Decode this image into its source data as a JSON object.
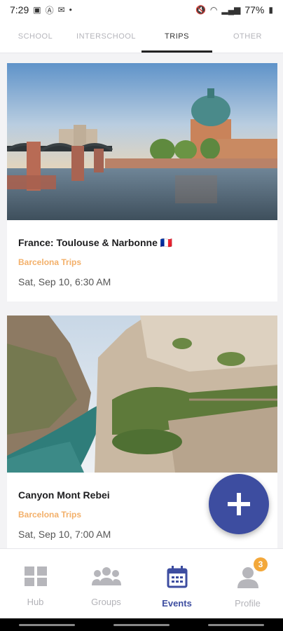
{
  "status_bar": {
    "time": "7:29",
    "battery": "77%"
  },
  "tabs": [
    {
      "label": "SCHOOL",
      "active": false
    },
    {
      "label": "INTERSCHOOL",
      "active": false
    },
    {
      "label": "TRIPS",
      "active": true
    },
    {
      "label": "OTHER",
      "active": false
    }
  ],
  "events": [
    {
      "title": "France: Toulouse & Narbonne 🇫🇷",
      "organizer": "Barcelona Trips",
      "date": "Sat, Sep 10, 6:30 AM"
    },
    {
      "title": "Canyon Mont Rebei",
      "organizer": "Barcelona Trips",
      "date": "Sat, Sep 10, 7:00 AM"
    }
  ],
  "fab": {
    "icon": "plus-icon"
  },
  "bottom_nav": [
    {
      "label": "Hub",
      "icon": "grid-icon",
      "active": false
    },
    {
      "label": "Groups",
      "icon": "groups-icon",
      "active": false
    },
    {
      "label": "Events",
      "icon": "calendar-icon",
      "active": true
    },
    {
      "label": "Profile",
      "icon": "profile-icon",
      "active": false,
      "badge": "3"
    }
  ],
  "colors": {
    "accent": "#3d4da0",
    "organizer": "#f3b06a",
    "badge": "#f3a83a"
  }
}
